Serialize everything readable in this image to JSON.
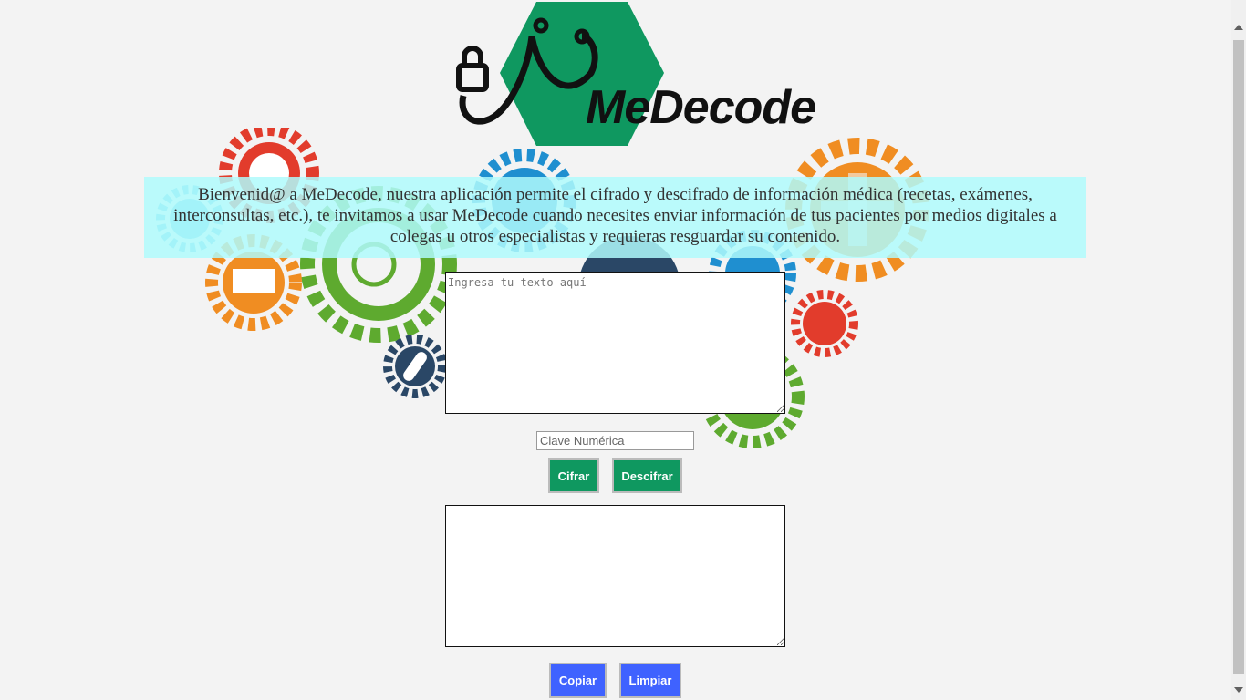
{
  "app": {
    "logo_text": "MeDecode"
  },
  "welcome": {
    "text": "Bienvenid@ a MeDecode, nuestra aplicación permite el cifrado y descifrado de información médica (recetas, exámenes, interconsultas, etc.), te invitamos a usar MeDecode cuando necesites enviar información de tus pacientes por medios digitales a colegas u otros especialistas y requieras resguardar su contenido."
  },
  "input": {
    "placeholder": "Ingresa tu texto aquí",
    "value": ""
  },
  "key": {
    "placeholder": "Clave Numérica",
    "value": ""
  },
  "actions": {
    "encrypt_label": "Cifrar",
    "decrypt_label": "Descifrar"
  },
  "output": {
    "value": ""
  },
  "output_actions": {
    "copy_label": "Copiar",
    "clear_label": "Limpiar"
  },
  "colors": {
    "brand_green": "#0f9860",
    "accent_blue": "#3f62ff",
    "banner_cyan": "#affafc"
  }
}
